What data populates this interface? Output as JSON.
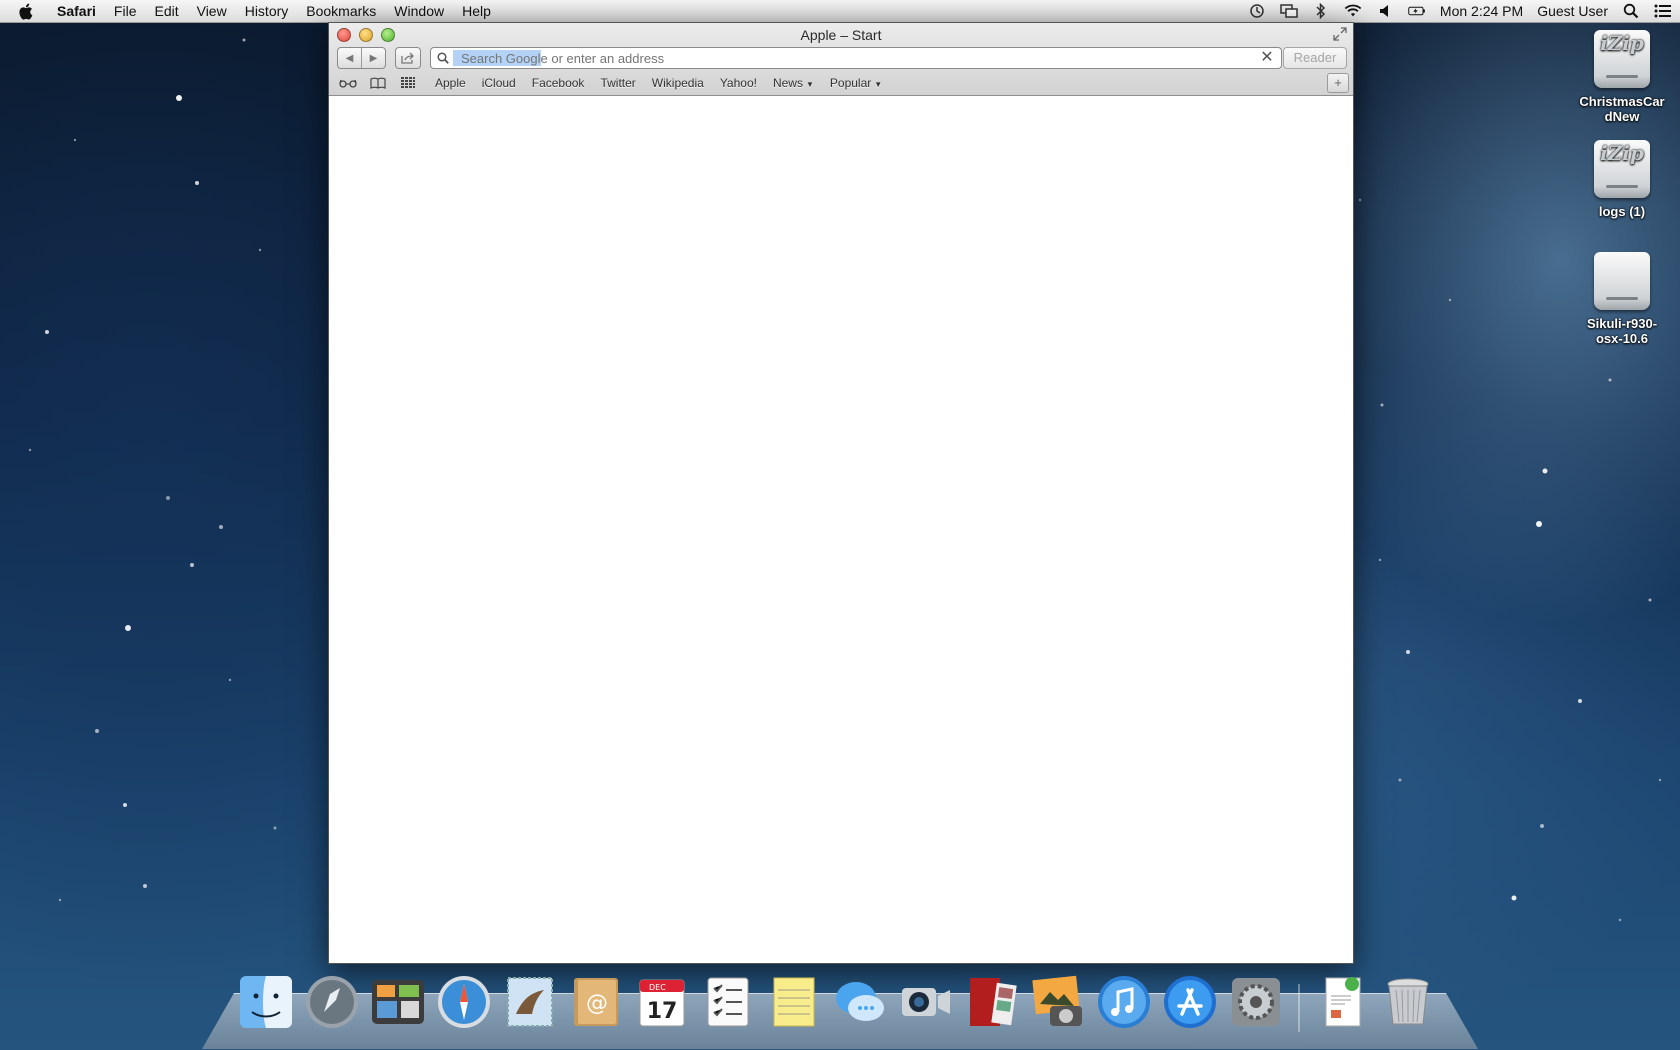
{
  "menubar": {
    "app_name": "Safari",
    "items": [
      "File",
      "Edit",
      "View",
      "History",
      "Bookmarks",
      "Window",
      "Help"
    ],
    "clock": "Mon 2:24 PM",
    "user": "Guest User",
    "status_icons": [
      "time-machine-icon",
      "mirroring-icon",
      "bluetooth-icon",
      "wifi-icon",
      "volume-icon",
      "battery-icon",
      "spotlight-icon",
      "notification-center-icon"
    ]
  },
  "window": {
    "title": "Apple – Start",
    "address_placeholder": "Search Google or enter an address",
    "reader_label": "Reader",
    "new_tab_label": "+",
    "bookmarks": [
      "Apple",
      "iCloud",
      "Facebook",
      "Twitter",
      "Wikipedia",
      "Yahoo!"
    ],
    "bookmark_folders": [
      "News",
      "Popular"
    ]
  },
  "desktop_icons": [
    {
      "label": "ChristmasCardNew",
      "icon": "izip-disk-icon",
      "badge": "iZip"
    },
    {
      "label": "logs (1)",
      "icon": "izip-disk-icon",
      "badge": "iZip"
    },
    {
      "label": "Sikuli-r930-osx-10.6",
      "icon": "disk-image-icon"
    }
  ],
  "dock": {
    "apps": [
      "finder-icon",
      "launchpad-icon",
      "mission-control-icon",
      "safari-icon",
      "mail-icon",
      "contacts-icon",
      "calendar-icon",
      "reminders-icon",
      "notes-icon",
      "messages-icon",
      "facetime-icon",
      "photo-booth-icon",
      "iphoto-icon",
      "itunes-icon",
      "app-store-icon",
      "system-preferences-icon"
    ],
    "calendar_month": "DEC",
    "calendar_day": "17",
    "stacks": [
      "document-stack-icon",
      "trash-icon"
    ]
  },
  "colors": {
    "desktop_dark": "#0b1a2e",
    "desktop_light": "#25557f",
    "selection": "#b3d2f5",
    "close": "#e0443a",
    "minimize": "#dea123",
    "zoom": "#4fb02d"
  }
}
